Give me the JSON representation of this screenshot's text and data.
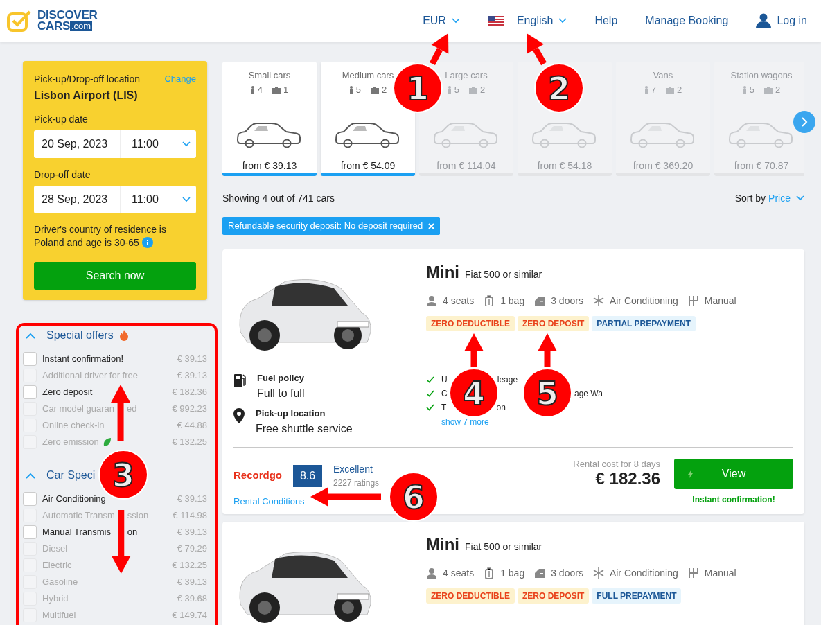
{
  "header": {
    "logo_top": "DISCOVER",
    "logo_bottom": "CARS",
    "logo_domain": ".com",
    "nav": [
      {
        "kind": "dropdown",
        "label": "EUR"
      },
      {
        "kind": "language",
        "label": "English"
      },
      {
        "kind": "link",
        "label": "Help"
      },
      {
        "kind": "link",
        "label": "Manage Booking"
      },
      {
        "kind": "user",
        "label": "Log in"
      }
    ]
  },
  "search": {
    "location_label": "Pick-up/Drop-off location",
    "change_link": "Change",
    "location": "Lisbon Airport (LIS)",
    "dates": [
      {
        "label": "Pick-up date",
        "date": "20 Sep, 2023",
        "time": "11:00"
      },
      {
        "label": "Drop-off date",
        "date": "28 Sep, 2023",
        "time": "11:00"
      }
    ],
    "residence_text": "Driver's country of residence is",
    "country": "Poland",
    "age_text": "and age is",
    "age": "30-65",
    "button": "Search now"
  },
  "filters": [
    {
      "title": "Special offers",
      "hot": true,
      "expanded": true,
      "options": [
        {
          "label": "Instant confirmation!",
          "price": "€ 39.13",
          "disabled": false,
          "eco": false
        },
        {
          "label": "Additional driver for free",
          "price": "€ 39.13",
          "disabled": true,
          "eco": false
        },
        {
          "label": "Zero deposit",
          "price": "€ 182.36",
          "disabled": false,
          "eco": false
        },
        {
          "label": [
            "Car model guaran",
            "ed"
          ],
          "price": "€ 992.23",
          "disabled": true,
          "eco": false
        },
        {
          "label": "Online check-in",
          "price": "€ 44.88",
          "disabled": true,
          "eco": false
        },
        {
          "label": "Zero emission",
          "price": "€ 132.25",
          "disabled": true,
          "eco": true
        }
      ]
    },
    {
      "title": "Car Speci",
      "hot": false,
      "expanded": true,
      "options": [
        {
          "label": "Air Conditioning",
          "price": "€ 39.13",
          "disabled": false,
          "eco": false
        },
        {
          "label": [
            "Automatic Transm",
            "ssion"
          ],
          "price": "€ 114.98",
          "disabled": true,
          "eco": false
        },
        {
          "label": [
            "Manual Transmis",
            "on"
          ],
          "price": "€ 39.13",
          "disabled": false,
          "eco": false
        },
        {
          "label": "Diesel",
          "price": "€ 79.29",
          "disabled": true,
          "eco": false
        },
        {
          "label": "Electric",
          "price": "€ 132.25",
          "disabled": true,
          "eco": false
        },
        {
          "label": "Gasoline",
          "price": "€ 39.13",
          "disabled": true,
          "eco": false
        },
        {
          "label": "Hybrid",
          "price": "€ 39.68",
          "disabled": true,
          "eco": false
        },
        {
          "label": "Multifuel",
          "price": "€ 149.74",
          "disabled": true,
          "eco": false
        }
      ]
    }
  ],
  "categories": [
    {
      "name": "Small cars",
      "seats": "4",
      "bags": "1",
      "price": "from € 39.13",
      "selected": true
    },
    {
      "name": "Medium cars",
      "seats": "5",
      "bags": "2",
      "price": "from € 54.09",
      "selected": true
    },
    {
      "name": "Large cars",
      "seats": "5",
      "bags": "2",
      "price": "from € 114.04",
      "selected": false
    },
    {
      "price": "from € 54.18",
      "selected": false
    },
    {
      "name": "Vans",
      "seats": "7",
      "bags": "2",
      "price": "from € 369.20",
      "selected": false
    },
    {
      "name": "Station wagons",
      "seats": "5",
      "bags": "2",
      "price": "from € 70.87",
      "selected": false
    }
  ],
  "results": {
    "count": "Showing 4 out of 741 cars",
    "sort_label": "Sort by",
    "sort_value": "Price",
    "chips": [
      "Refundable security deposit: No deposit required"
    ]
  },
  "listings": [
    {
      "title": "Mini",
      "subtitle": "Fiat 500 or similar",
      "features": [
        {
          "kind": "seats",
          "label": "4 seats"
        },
        {
          "kind": "bag",
          "label": "1 bag"
        },
        {
          "kind": "doors",
          "label": "3 doors"
        },
        {
          "kind": "ac",
          "label": "Air Conditioning"
        },
        {
          "kind": "gear",
          "label": "Manual"
        }
      ],
      "tags": [
        {
          "kind": "warn",
          "label": "ZERO DEDUCTIBLE"
        },
        {
          "kind": "warn",
          "label": "ZERO DEPOSIT"
        },
        {
          "kind": "info",
          "label": "PARTIAL PREPAYMENT"
        }
      ],
      "details": [
        {
          "kind": "fuel",
          "label": "Fuel policy",
          "value": "Full to full"
        },
        {
          "kind": "pin",
          "label": "Pick-up location",
          "value": "Free shuttle service"
        }
      ],
      "perks": [
        [
          "U",
          "leage"
        ],
        [
          "C",
          "age Wa"
        ],
        [
          "T",
          "on"
        ]
      ],
      "more": "show 7 more",
      "supplier": "Recordgo",
      "score": "8.6",
      "rating": "Excellent",
      "ratings": "2227 ratings",
      "conditions": "Rental Conditions",
      "cost_label": "Rental cost for 8 days",
      "price": "€ 182.36",
      "button": "View",
      "confirmation": "Instant confirmation!"
    },
    {
      "title": "Mini",
      "subtitle": "Fiat 500 or similar",
      "features": [
        {
          "kind": "seats",
          "label": "4 seats"
        },
        {
          "kind": "bag",
          "label": "1 bag"
        },
        {
          "kind": "doors",
          "label": "3 doors"
        },
        {
          "kind": "ac",
          "label": "Air Conditioning"
        },
        {
          "kind": "gear",
          "label": "Manual"
        }
      ],
      "tags": [
        {
          "kind": "warn",
          "label": "ZERO DEDUCTIBLE"
        },
        {
          "kind": "warn",
          "label": "ZERO DEPOSIT"
        },
        {
          "kind": "info",
          "label": "FULL PREPAYMENT"
        }
      ]
    }
  ],
  "annotations": [
    {
      "label": "1"
    },
    {
      "label": "2"
    },
    {
      "label": "3"
    },
    {
      "label": "4"
    },
    {
      "label": "5"
    },
    {
      "label": "6"
    }
  ]
}
